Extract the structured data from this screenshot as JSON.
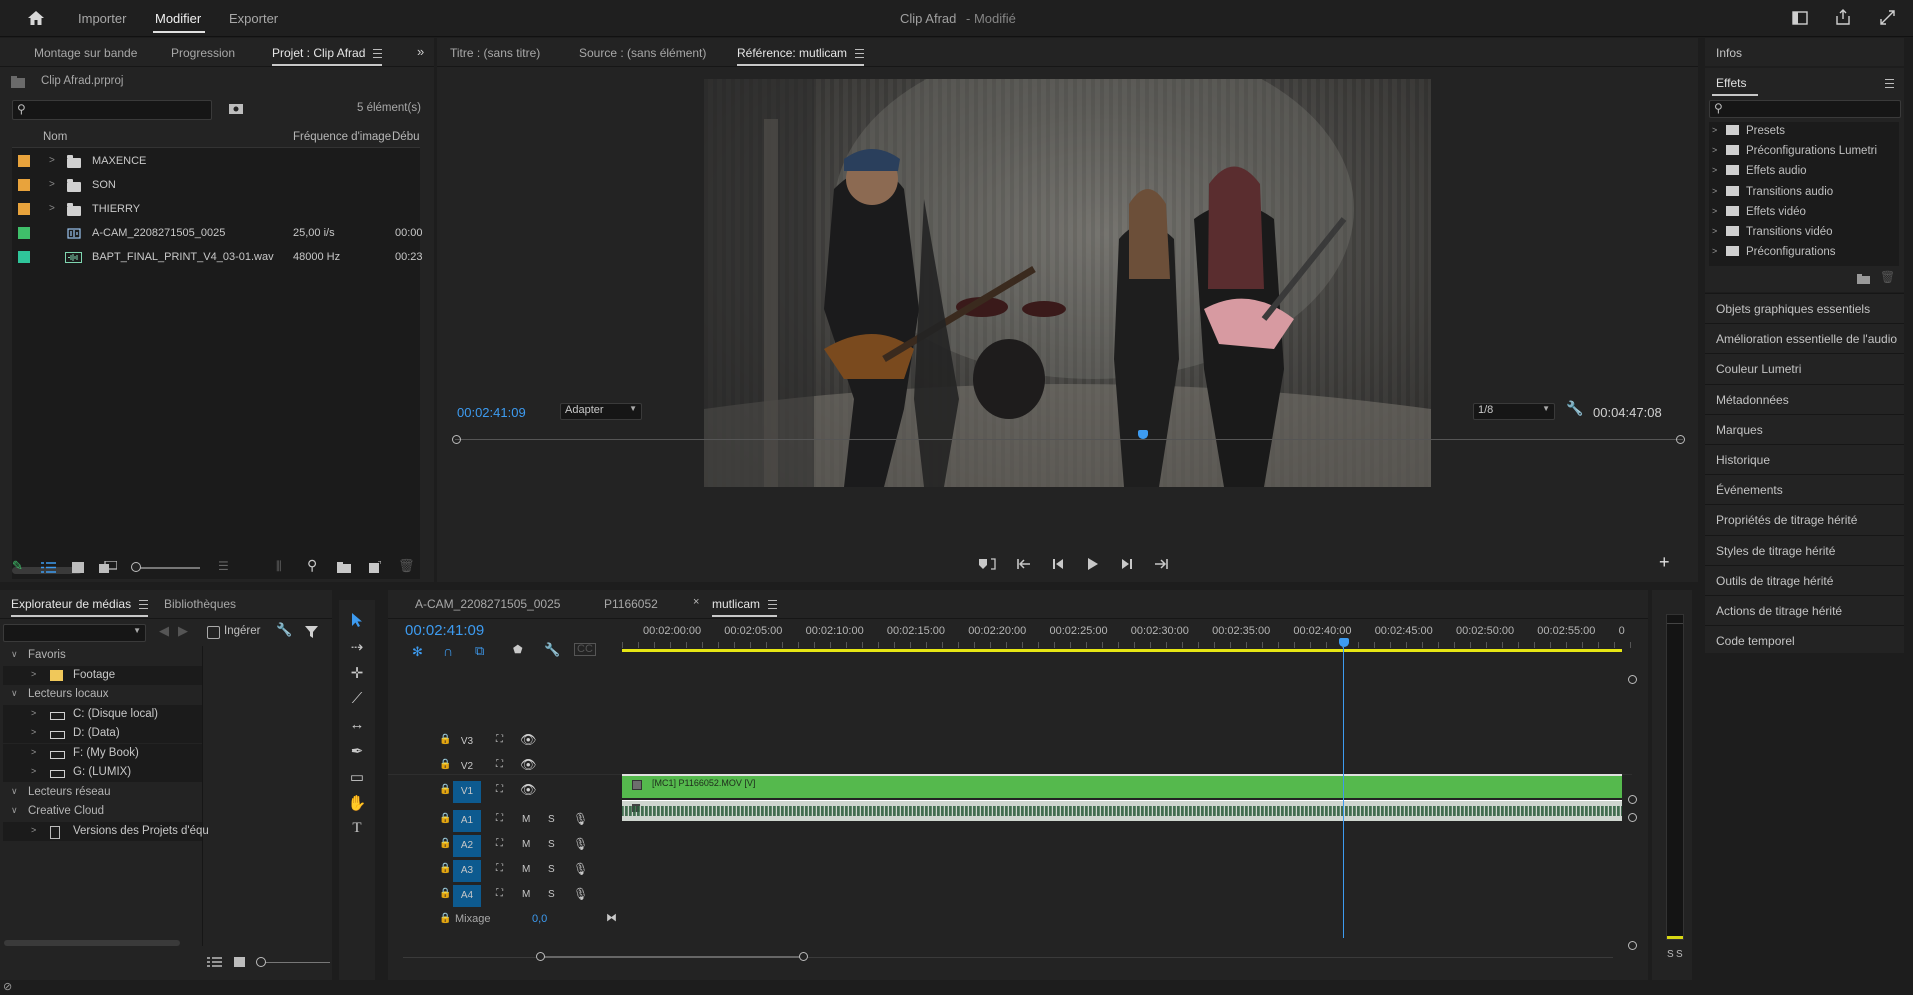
{
  "top_bar": {
    "nav": [
      "Importer",
      "Modifier",
      "Exporter"
    ],
    "active_nav": "Modifier",
    "title": "Clip Afrad",
    "title_status": "- Modifié"
  },
  "project_panel": {
    "tabs": [
      "Montage sur bande",
      "Progression",
      "Projet : Clip Afrad"
    ],
    "project_file": "Clip Afrad.prproj",
    "count": "5 élément(s)",
    "columns": [
      "Nom",
      "Fréquence d'image",
      "Débu"
    ],
    "items": [
      {
        "name": "MAXENCE",
        "color": "#e8a33c",
        "type": "folder",
        "rate": "",
        "start": ""
      },
      {
        "name": "SON",
        "color": "#e8a33c",
        "type": "folder",
        "rate": "",
        "start": ""
      },
      {
        "name": "THIERRY",
        "color": "#e8a33c",
        "type": "folder",
        "rate": "",
        "start": ""
      },
      {
        "name": "A-CAM_2208271505_0025",
        "color": "#3fbf6a",
        "type": "sequence",
        "rate": "25,00 i/s",
        "start": "00:00"
      },
      {
        "name": "BAPT_FINAL_PRINT_V4_03-01.wav",
        "color": "#2fc59a",
        "type": "audio",
        "rate": "48000  Hz",
        "start": "00:23"
      }
    ]
  },
  "monitor": {
    "tabs": [
      "Titre : (sans titre)",
      "Source : (sans élément)",
      "Référence: mutlicam"
    ],
    "timecode": "00:02:41:09",
    "fit": "Adapter",
    "quality": "1/8",
    "duration": "00:04:47:08",
    "playhead_fraction": 0.56
  },
  "media_browser": {
    "tabs": [
      "Explorateur de médias",
      "Bibliothèques"
    ],
    "ingest_label": "Ingérer",
    "tree": [
      {
        "label": "Favoris",
        "level": 0,
        "type": "group"
      },
      {
        "label": "Footage",
        "level": 1,
        "type": "folder"
      },
      {
        "label": "Lecteurs locaux",
        "level": 0,
        "type": "group"
      },
      {
        "label": "C: (Disque local)",
        "level": 1,
        "type": "drive"
      },
      {
        "label": "D: (Data)",
        "level": 1,
        "type": "drive"
      },
      {
        "label": "F: (My Book)",
        "level": 1,
        "type": "drive"
      },
      {
        "label": "G: (LUMIX)",
        "level": 1,
        "type": "drive"
      },
      {
        "label": "Lecteurs réseau",
        "level": 0,
        "type": "group"
      },
      {
        "label": "Creative Cloud",
        "level": 0,
        "type": "group"
      },
      {
        "label": "Versions des Projets d'équ",
        "level": 1,
        "type": "doc"
      }
    ]
  },
  "timeline": {
    "tabs": [
      "A-CAM_2208271505_0025",
      "P1166052",
      "mutlicam"
    ],
    "active_tab": "mutlicam",
    "timecode": "00:02:41:09",
    "ruler": [
      "00:02:00:00",
      "00:02:05:00",
      "00:02:10:00",
      "00:02:15:00",
      "00:02:20:00",
      "00:02:25:00",
      "00:02:30:00",
      "00:02:35:00",
      "00:02:40:00",
      "00:02:45:00",
      "00:02:50:00",
      "00:02:55:00",
      "0"
    ],
    "video_tracks": [
      "V3",
      "V2",
      "V1"
    ],
    "audio_tracks": [
      "A1",
      "A2",
      "A3",
      "A4"
    ],
    "mute_label": "M",
    "solo_label": "S",
    "mix_label": "Mixage",
    "mix_value": "0,0",
    "clip_label": "[MC1] P1166052.MOV [V]",
    "playhead_fraction": 0.722
  },
  "effects_panel": {
    "info_title": "Infos",
    "title": "Effets",
    "items": [
      "Presets",
      "Préconfigurations Lumetri",
      "Effets audio",
      "Transitions audio",
      "Effets vidéo",
      "Transitions vidéo",
      "Préconfigurations"
    ]
  },
  "right_panels": [
    "Objets graphiques essentiels",
    "Amélioration essentielle de l'audio",
    "Couleur Lumetri",
    "Métadonnées",
    "Marques",
    "Historique",
    "Événements",
    "Propriétés de titrage hérité",
    "Styles de titrage hérité",
    "Outils de titrage hérité",
    "Actions de titrage hérité",
    "Code temporel"
  ],
  "meter": {
    "solo_labels": [
      "S",
      "S"
    ]
  }
}
